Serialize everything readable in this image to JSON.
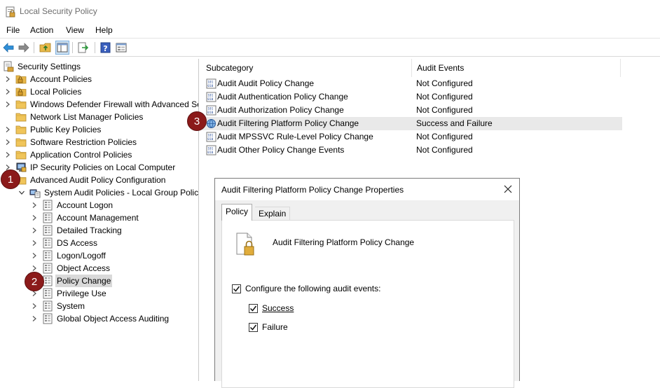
{
  "window": {
    "title": "Local Security Policy"
  },
  "menu": [
    "File",
    "Action",
    "View",
    "Help"
  ],
  "toolbar": {
    "buttons": [
      "back-arrow-icon",
      "forward-arrow-icon",
      "up-folder-icon",
      "show-hide-tree-icon",
      "export-list-icon",
      "help-icon",
      "properties-icon"
    ]
  },
  "tree": [
    {
      "label": "Security Settings",
      "level": 0,
      "expander": "none",
      "icon": "security-settings-icon"
    },
    {
      "label": "Account Policies",
      "level": 1,
      "expander": "collapsed",
      "icon": "folder-lock-icon"
    },
    {
      "label": "Local Policies",
      "level": 1,
      "expander": "collapsed",
      "icon": "folder-lock-icon"
    },
    {
      "label": "Windows Defender Firewall with Advanced Se",
      "level": 1,
      "expander": "collapsed",
      "icon": "folder-icon"
    },
    {
      "label": "Network List Manager Policies",
      "level": 1,
      "expander": "none",
      "icon": "folder-icon"
    },
    {
      "label": "Public Key Policies",
      "level": 1,
      "expander": "collapsed",
      "icon": "folder-icon"
    },
    {
      "label": "Software Restriction Policies",
      "level": 1,
      "expander": "collapsed",
      "icon": "folder-icon"
    },
    {
      "label": "Application Control Policies",
      "level": 1,
      "expander": "collapsed",
      "icon": "folder-icon"
    },
    {
      "label": "IP Security Policies on Local Computer",
      "level": 1,
      "expander": "collapsed",
      "icon": "ip-security-icon"
    },
    {
      "label": "Advanced Audit Policy Configuration",
      "level": 1,
      "expander": "expanded",
      "icon": "folder-icon"
    },
    {
      "label": "System Audit Policies - Local Group Polic",
      "level": 2,
      "expander": "expanded",
      "icon": "group-policy-icon"
    },
    {
      "label": "Account Logon",
      "level": 3,
      "expander": "collapsed",
      "icon": "audit-node-icon"
    },
    {
      "label": "Account Management",
      "level": 3,
      "expander": "collapsed",
      "icon": "audit-node-icon"
    },
    {
      "label": "Detailed Tracking",
      "level": 3,
      "expander": "collapsed",
      "icon": "audit-node-icon"
    },
    {
      "label": "DS Access",
      "level": 3,
      "expander": "collapsed",
      "icon": "audit-node-icon"
    },
    {
      "label": "Logon/Logoff",
      "level": 3,
      "expander": "collapsed",
      "icon": "audit-node-icon"
    },
    {
      "label": "Object Access",
      "level": 3,
      "expander": "collapsed",
      "icon": "audit-node-icon"
    },
    {
      "label": "Policy Change",
      "level": 3,
      "expander": "collapsed",
      "icon": "audit-node-icon",
      "selected": true
    },
    {
      "label": "Privilege Use",
      "level": 3,
      "expander": "collapsed",
      "icon": "audit-node-icon"
    },
    {
      "label": "System",
      "level": 3,
      "expander": "collapsed",
      "icon": "audit-node-icon"
    },
    {
      "label": "Global Object Access Auditing",
      "level": 3,
      "expander": "collapsed",
      "icon": "audit-node-icon"
    }
  ],
  "list": {
    "columns": [
      "Subcategory",
      "Audit Events"
    ],
    "rows": [
      {
        "name": "Audit Audit Policy Change",
        "value": "Not Configured"
      },
      {
        "name": "Audit Authentication Policy Change",
        "value": "Not Configured"
      },
      {
        "name": "Audit Authorization Policy Change",
        "value": "Not Configured"
      },
      {
        "name": "Audit Filtering Platform Policy Change",
        "value": "Success and Failure",
        "highlight": true
      },
      {
        "name": "Audit MPSSVC Rule-Level Policy Change",
        "value": "Not Configured"
      },
      {
        "name": "Audit Other Policy Change Events",
        "value": "Not Configured"
      }
    ]
  },
  "callouts": [
    "1",
    "2",
    "3"
  ],
  "dialog": {
    "title": "Audit Filtering Platform Policy Change Properties",
    "tabs": [
      "Policy",
      "Explain"
    ],
    "active_tab": "Policy",
    "policy_name": "Audit Filtering Platform Policy Change",
    "configure_label": "Configure the following audit events:",
    "configure_checked": true,
    "success_label": "Success",
    "success_checked": true,
    "failure_label": "Failure",
    "failure_checked": true
  },
  "colors": {
    "callout": "#8b1a1a",
    "selection": "#d9d9d9",
    "row_highlight": "#e9e9e9",
    "folder": "#e8b84a"
  }
}
